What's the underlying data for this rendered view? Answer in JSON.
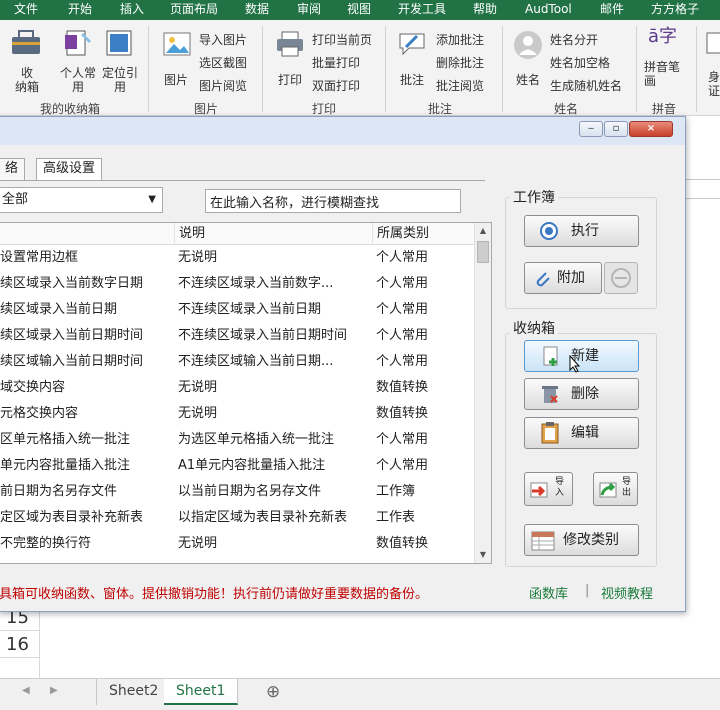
{
  "ribbon_tabs": [
    "文件",
    "开始",
    "插入",
    "页面布局",
    "数据",
    "审阅",
    "视图",
    "开发工具",
    "帮助",
    "AudTool",
    "邮件",
    "方方格子"
  ],
  "ribbon": {
    "btn_collect": "收\n纳箱",
    "btn_personal": "个人常\n用",
    "btn_locate": "定位引\n用",
    "group_box": "我的收纳箱",
    "btn_picture": "图片",
    "img_import": "导入图片",
    "img_crop": "选区截图",
    "img_view": "图片阅览",
    "group_picture": "图片",
    "btn_print": "打印",
    "print_current": "打印当前页",
    "print_batch": "批量打印",
    "print_duplex": "双面打印",
    "group_print": "打印",
    "btn_comment": "批注",
    "comment_add": "添加批注",
    "comment_delete": "删除批注",
    "comment_view": "批注阅览",
    "group_comment": "批注",
    "btn_name": "姓名",
    "name_split": "姓名分开",
    "name_space": "姓名加空格",
    "name_random": "生成随机姓名",
    "group_name": "姓名",
    "btn_pinyin": "拼音笔\n画",
    "group_pinyin": "拼音",
    "btn_partial": "身\n证"
  },
  "sheet": {
    "rows": [
      "15",
      "16"
    ],
    "tabs": [
      "Sheet2",
      "Sheet1"
    ],
    "active_tab": "Sheet1",
    "add_sheet": "⊕"
  },
  "dialog": {
    "window_buttons": [
      "‒",
      "▫",
      "×"
    ],
    "tabs": [
      "络",
      "高级设置"
    ],
    "category_value": "全部",
    "search_value": "在此输入名称，进行模糊查找",
    "columns": [
      "",
      "说明",
      "所属类别"
    ],
    "rows": [
      [
        "设置常用边框",
        "无说明",
        "个人常用"
      ],
      [
        "续区域录入当前数字日期",
        "不连续区域录入当前数字...",
        "个人常用"
      ],
      [
        "续区域录入当前日期",
        "不连续区域录入当前日期",
        "个人常用"
      ],
      [
        "续区域录入当前日期时间",
        "不连续区域录入当前日期时间",
        "个人常用"
      ],
      [
        "续区域输入当前日期时间",
        "不连续区域输入当前日期...",
        "个人常用"
      ],
      [
        "域交换内容",
        "无说明",
        "数值转换"
      ],
      [
        "元格交换内容",
        "无说明",
        "数值转换"
      ],
      [
        "区单元格插入统一批注",
        "为选区单元格插入统一批注",
        "个人常用"
      ],
      [
        "单元内容批量插入批注",
        "A1单元内容批量插入批注",
        "个人常用"
      ],
      [
        "前日期为名另存文件",
        "以当前日期为名另存文件",
        "工作簿"
      ],
      [
        "定区域为表目录补充新表",
        "以指定区域为表目录补充新表",
        "工作表"
      ],
      [
        "不完整的换行符",
        "无说明",
        "数值转换"
      ]
    ],
    "workbook_group": "工作簿",
    "btn_execute": "执行",
    "btn_attach": "附加",
    "box_group": "收纳箱",
    "btn_new": "新建",
    "btn_delete": "删除",
    "btn_edit": "编辑",
    "btn_import": "导入",
    "btn_export": "导出",
    "btn_change_category": "修改类别",
    "status": "具箱可收纳函数、窗体。提供撤销功能！执行前仍请做好重要数据的备份。",
    "link_functions": "函数库",
    "link_sep": "|",
    "link_videos": "视频教程"
  },
  "colors": {
    "excel_green": "#217346",
    "warning_red": "#c00000",
    "link_green": "#1a7a3a"
  }
}
